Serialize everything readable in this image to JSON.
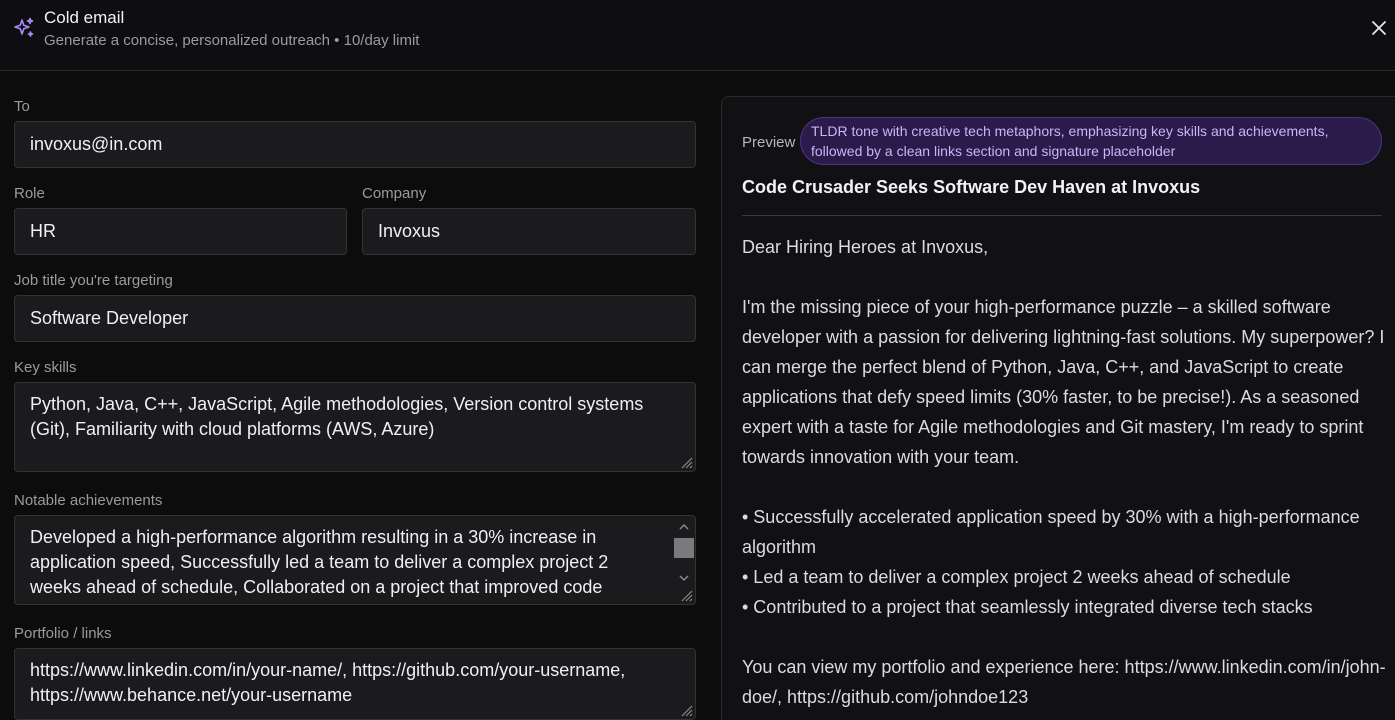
{
  "header": {
    "title": "Cold email",
    "subtitle": "Generate a concise, personalized outreach • 10/day limit",
    "icon": "sparkles-icon",
    "close_icon": "close-icon"
  },
  "form": {
    "to": {
      "label": "To",
      "value": "invoxus@in.com"
    },
    "role": {
      "label": "Role",
      "value": "HR"
    },
    "company": {
      "label": "Company",
      "value": "Invoxus"
    },
    "job_title": {
      "label": "Job title you're targeting",
      "value": "Software Developer"
    },
    "skills": {
      "label": "Key skills",
      "value": "Python, Java, C++, JavaScript, Agile methodologies, Version control systems (Git), Familiarity with cloud platforms (AWS, Azure)"
    },
    "achievements": {
      "label": "Notable achievements",
      "value": "Developed a high-performance algorithm resulting in a 30% increase in application speed, Successfully led a team to deliver a complex project 2 weeks ahead of schedule, Collaborated on a project that improved code"
    },
    "portfolio": {
      "label": "Portfolio / links",
      "value": "https://www.linkedin.com/in/your-name/, https://github.com/your-username, https://www.behance.net/your-username"
    }
  },
  "preview": {
    "label": "Preview",
    "tone": "TLDR tone with creative tech metaphors, emphasizing key skills and achievements, followed by a clean links section and signature placeholder",
    "subject": "Code Crusader Seeks Software Dev Haven at Invoxus",
    "greeting": "Dear Hiring Heroes at Invoxus,",
    "paragraph1": "I'm the missing piece of your high-performance puzzle – a skilled software developer with a passion for delivering lightning-fast solutions. My superpower? I can merge the perfect blend of Python, Java, C++, and JavaScript to create applications that defy speed limits (30% faster, to be precise!). As a seasoned expert with a taste for Agile methodologies and Git mastery, I'm ready to sprint towards innovation with your team.",
    "bullets": [
      "• Successfully accelerated application speed by 30% with a high-performance algorithm",
      "• Led a team to deliver a complex project 2 weeks ahead of schedule",
      "• Contributed to a project that seamlessly integrated diverse tech stacks"
    ],
    "portfolio_line": "You can view my portfolio and experience here: https://www.linkedin.com/in/john-doe/, https://github.com/johndoe123"
  },
  "colors": {
    "background": "#0c0c0d",
    "accent": "#a78bfa",
    "tone_badge_bg": "#2a1b4a"
  }
}
